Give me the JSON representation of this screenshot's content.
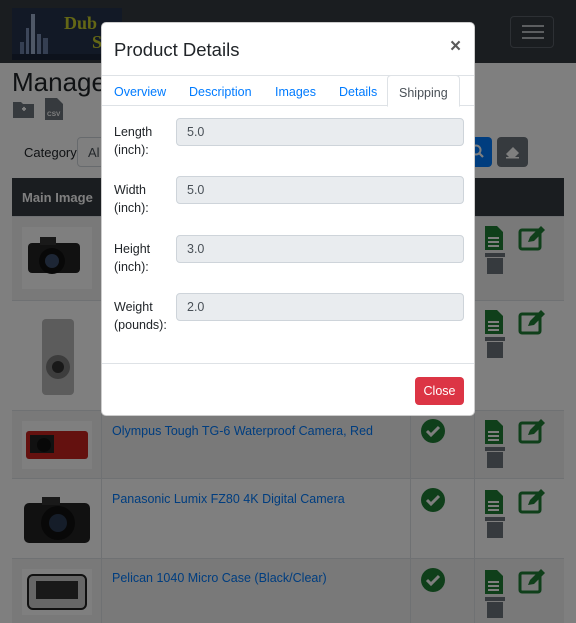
{
  "navbar": {
    "logo_line1": "Dub",
    "logo_line2": "S"
  },
  "page": {
    "title": "Manage",
    "csv_label": "CSV"
  },
  "filter": {
    "category_label": "Category:",
    "category_value": "Al"
  },
  "table": {
    "main_image_header": "Main Image",
    "rows": [
      {
        "name": ""
      },
      {
        "name": ""
      },
      {
        "name": "Olympus Tough TG-6 Waterproof Camera, Red"
      },
      {
        "name": "Panasonic Lumix FZ80 4K Digital Camera"
      },
      {
        "name": "Pelican 1040 Micro Case (Black/Clear)"
      }
    ]
  },
  "modal": {
    "title": "Product Details",
    "close_symbol": "×",
    "tabs": [
      "Overview",
      "Description",
      "Images",
      "Details",
      "Shipping"
    ],
    "active_tab": "Shipping",
    "fields": [
      {
        "label": "Length (inch):",
        "value": "5.0"
      },
      {
        "label": "Width (inch):",
        "value": "5.0"
      },
      {
        "label": "Height (inch):",
        "value": "3.0"
      },
      {
        "label": "Weight (pounds):",
        "value": "2.0"
      }
    ],
    "close_button": "Close"
  },
  "colors": {
    "primary": "#007bff",
    "danger": "#dc3545",
    "success": "#1e7e34",
    "dark": "#343a40"
  }
}
